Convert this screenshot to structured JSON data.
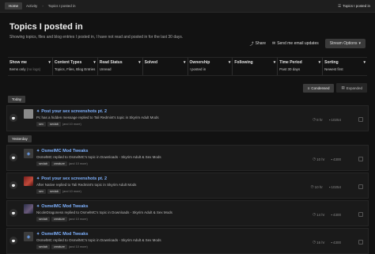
{
  "breadcrumb": [
    "Home",
    "Activity",
    "Topics I posted in"
  ],
  "top_right": "Topics I posted in",
  "header": {
    "title": "Topics I posted in",
    "subtitle": "Showing topics, files and blog entries I posted in, I have not read and posted in for the last 30 days.",
    "share": "Share",
    "email": "Send me email updates",
    "stream_options": "Stream Options"
  },
  "filters": [
    {
      "label": "Show me",
      "value": "Items only",
      "muted": "(no logs)"
    },
    {
      "label": "Content Types",
      "value": "Topics, Files, Blog Entries",
      "muted": ""
    },
    {
      "label": "Read Status",
      "value": "Unread",
      "muted": ""
    },
    {
      "label": "Solved",
      "value": "",
      "muted": ""
    },
    {
      "label": "Ownership",
      "value": "I posted in",
      "muted": ""
    },
    {
      "label": "Following",
      "value": "",
      "muted": ""
    },
    {
      "label": "Time Period",
      "value": "Past 30 days",
      "muted": ""
    },
    {
      "label": "Sorting",
      "value": "Newest first",
      "muted": ""
    }
  ],
  "view": {
    "condensed": "Condensed",
    "expanded": "Expanded"
  },
  "groups": [
    {
      "label": "Today",
      "items": [
        {
          "title": "Post your sex screenshots pt. 2",
          "desc": "Pc has a hidden message replied to Tali Redmint's topic in Skyrim Adult Mods",
          "tags": [
            "sex",
            "sexlab"
          ],
          "more": "(and 10 more)",
          "time": "8 hr",
          "count": "10254",
          "avatar": "grey"
        }
      ]
    },
    {
      "label": "Yesterday",
      "items": [
        {
          "title": "OsmelMC Mod Tweaks",
          "desc": "OsmelMC replied to OsmelMC's topic in Downloads - Skyrim Adult & Sex Mods",
          "tags": [
            "sexlab",
            "creature"
          ],
          "more": "(and 10 more)",
          "time": "10 hr",
          "count": "4300",
          "avatar": "mm"
        },
        {
          "title": "Post your sex screenshots pt. 2",
          "desc": "After Native replied to Tali Redmint's topic in Skyrim Adult Mods",
          "tags": [
            "sex",
            "sexlab"
          ],
          "more": "(and 10 more)",
          "time": "10 hr",
          "count": "10254",
          "avatar": "red"
        },
        {
          "title": "OsmelMC Mod Tweaks",
          "desc": "NicoleDragoness replied to OsmelMC's topic in Downloads - Skyrim Adult & Sex Mods",
          "tags": [
            "sexlab",
            "creature"
          ],
          "more": "(and 10 more)",
          "time": "14 hr",
          "count": "4300",
          "avatar": "face"
        },
        {
          "title": "OsmelMC Mod Tweaks",
          "desc": "OsmelMC replied to OsmelMC's topic in Downloads - Skyrim Adult & Sex Mods",
          "tags": [
            "sexlab",
            "creature"
          ],
          "more": "(and 10 more)",
          "time": "16 hr",
          "count": "4300",
          "avatar": "mm"
        }
      ]
    }
  ]
}
